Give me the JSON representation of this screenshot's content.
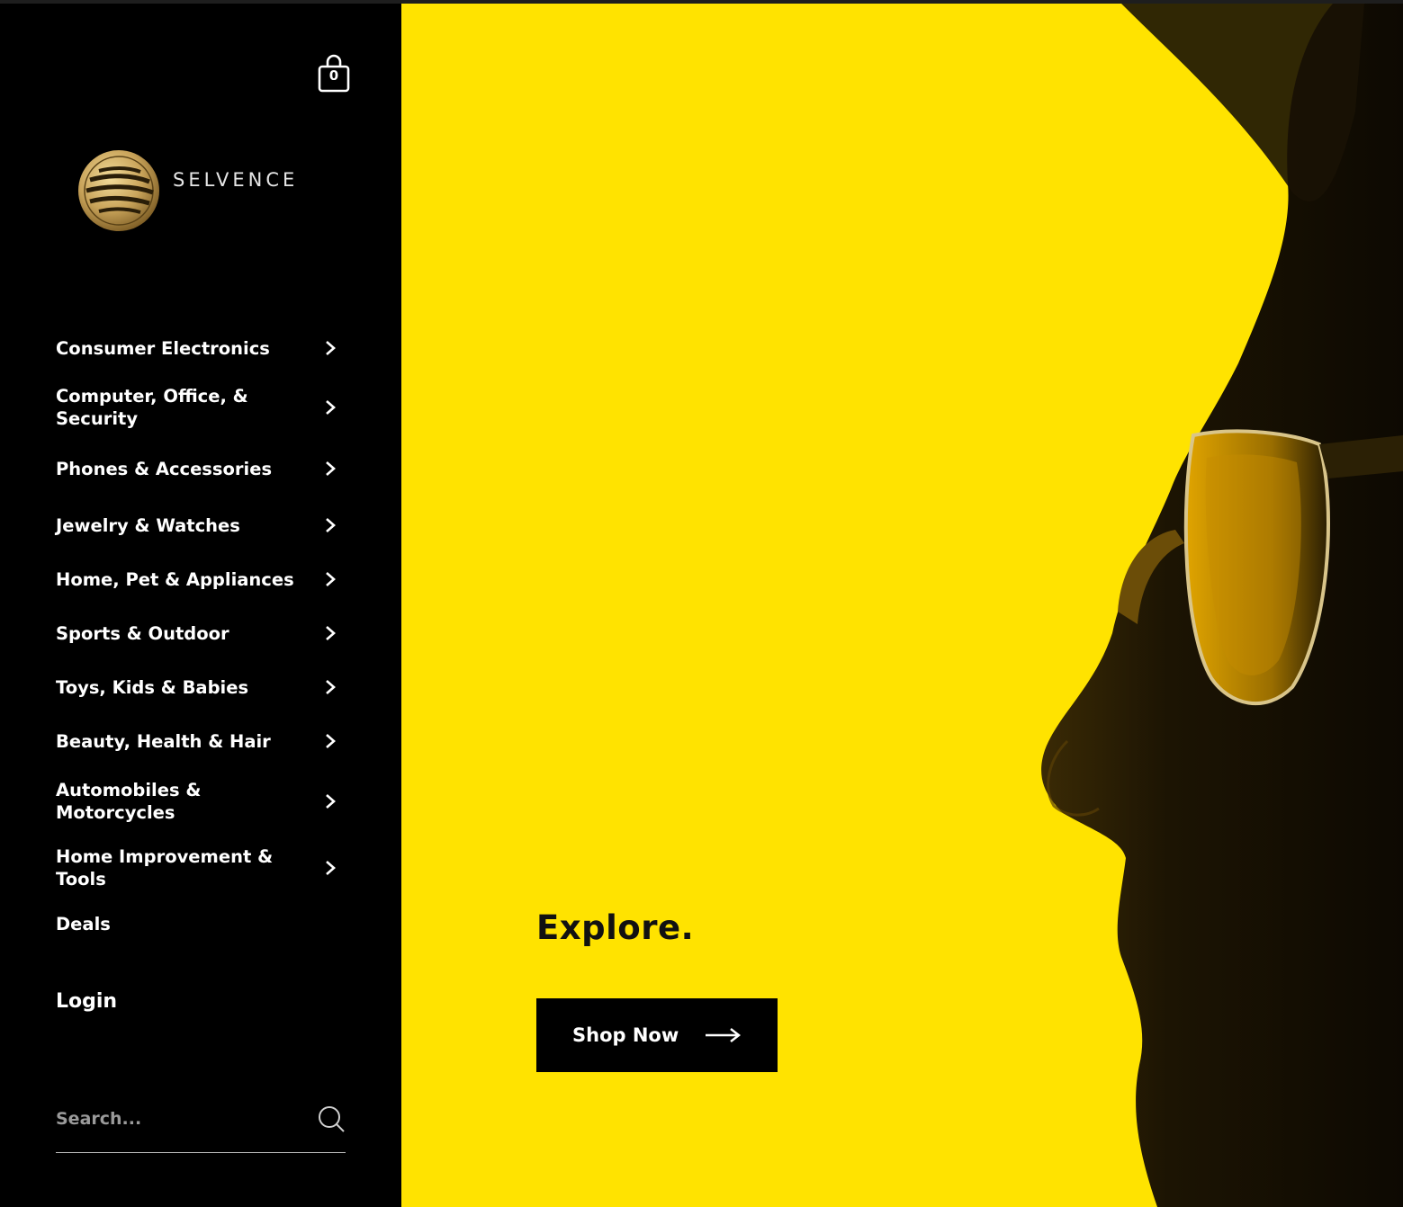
{
  "brand": {
    "name": "SELVENCE",
    "logo_color": "#c9a45a"
  },
  "cart": {
    "count": "0",
    "icon": "shopping-bag-icon"
  },
  "nav": {
    "items": [
      {
        "label": "Consumer Electronics",
        "has_submenu": true
      },
      {
        "label": "Computer, Office, & Security",
        "has_submenu": true
      },
      {
        "label": "Phones & Accessories",
        "has_submenu": true
      },
      {
        "label": "Jewelry & Watches",
        "has_submenu": true
      },
      {
        "label": "Home, Pet & Appliances",
        "has_submenu": true
      },
      {
        "label": "Sports & Outdoor",
        "has_submenu": true
      },
      {
        "label": "Toys, Kids & Babies",
        "has_submenu": true
      },
      {
        "label": "Beauty, Health & Hair",
        "has_submenu": true
      },
      {
        "label": "Automobiles & Motorcycles",
        "has_submenu": true
      },
      {
        "label": "Home Improvement & Tools",
        "has_submenu": true
      },
      {
        "label": "Deals",
        "has_submenu": false
      }
    ]
  },
  "account": {
    "login_label": "Login"
  },
  "search": {
    "placeholder": "Search...",
    "value": ""
  },
  "hero": {
    "heading": "Explore.",
    "cta_label": "Shop Now",
    "background_color": "#ffe300",
    "button_color": "#000000"
  }
}
